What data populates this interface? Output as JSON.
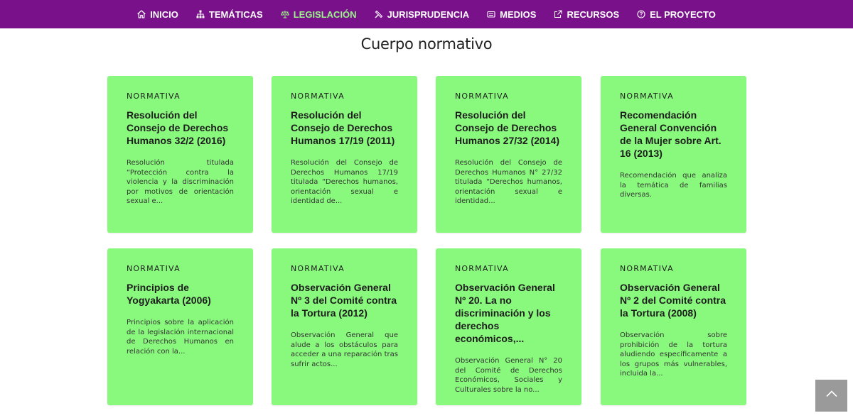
{
  "nav": {
    "items": [
      {
        "label": "INICIO",
        "icon": "home-icon"
      },
      {
        "label": "TEMÁTICAS",
        "icon": "sitemap-icon"
      },
      {
        "label": "LEGISLACIÓN",
        "icon": "balance-scale-icon",
        "active": true
      },
      {
        "label": "JURISPRUDENCIA",
        "icon": "gavel-icon"
      },
      {
        "label": "MEDIOS",
        "icon": "news-icon"
      },
      {
        "label": "RECURSOS",
        "icon": "external-link-icon"
      },
      {
        "label": "EL PROYECTO",
        "icon": "question-circle-icon"
      }
    ]
  },
  "page": {
    "title": "Cuerpo normativo"
  },
  "cards": [
    {
      "category": "NORMATIVA",
      "title": "Resolución del Consejo de Derechos Humanos 32/2 (2016)",
      "description": "Resolución titulada “Protección contra la violencia y la discriminación por motivos de orientación sexual e..."
    },
    {
      "category": "NORMATIVA",
      "title": "Resolución del Consejo de Derechos Humanos 17/19 (2011)",
      "description": "Resolución del Consejo de Derechos Humanos 17/19 titulada “Derechos humanos, orientación sexual e identidad de..."
    },
    {
      "category": "NORMATIVA",
      "title": "Resolución del Consejo de Derechos Humanos 27/32 (2014)",
      "description": "Resolución del Consejo de Derechos Humanos N° 27/32 titulada “Derechos humanos, orientación sexual e identidad..."
    },
    {
      "category": "NORMATIVA",
      "title": "Recomendación General Convención de la Mujer sobre Art. 16 (2013)",
      "description": "Recomendación que analiza la temática de familias diversas."
    },
    {
      "category": "NORMATIVA",
      "title": "Principios de Yogyakarta (2006)",
      "description": "Principios sobre la aplicación de la legislación internacional de Derechos Humanos en relación con la..."
    },
    {
      "category": "NORMATIVA",
      "title": "Observación General Nº 3 del Comité contra la Tortura (2012)",
      "description": "Observación General que alude a los obstáculos para acceder a una reparación tras sufrir actos..."
    },
    {
      "category": "NORMATIVA",
      "title": "Observación General Nº 20. La no discriminación y los derechos económicos,...",
      "description": "Observación General N° 20 del Comité de Derechos Económicos, Sociales y Culturales sobre la no..."
    },
    {
      "category": "NORMATIVA",
      "title": "Observación General Nº 2 del Comité contra la Tortura (2008)",
      "description": "Observación sobre prohibición de la tortura aludiendo específicamente a los grupos más vulnerables, incluida la..."
    }
  ],
  "back_to_top": {
    "icon": "chevron-up-icon"
  },
  "colors": {
    "navbar": "#78118a",
    "nav_active": "#9bf58a",
    "card": "#89f97d",
    "back_to_top": "#9a9a9a"
  }
}
